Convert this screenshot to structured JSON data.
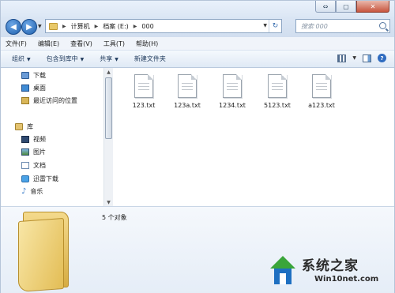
{
  "window": {
    "caption_buttons": [
      "⇔",
      "▢",
      "✕"
    ]
  },
  "address_bar": {
    "path": [
      "计算机",
      "档案 (E:)",
      "000"
    ],
    "search_placeholder": "搜索 000"
  },
  "menu": [
    "文件(F)",
    "编辑(E)",
    "查看(V)",
    "工具(T)",
    "帮助(H)"
  ],
  "toolbar": {
    "organize": "组织",
    "include_in_library": "包含到库中",
    "share": "共享",
    "new_folder": "新建文件夹"
  },
  "navigation": {
    "favorites": [
      {
        "label": "下载",
        "icon": "download-icon"
      },
      {
        "label": "桌面",
        "icon": "desktop-icon"
      },
      {
        "label": "最近访问的位置",
        "icon": "recent-places-icon"
      }
    ],
    "libraries_title": "库",
    "libraries": [
      {
        "label": "视频",
        "icon": "video-icon"
      },
      {
        "label": "图片",
        "icon": "picture-icon"
      },
      {
        "label": "文档",
        "icon": "document-icon"
      },
      {
        "label": "迅雷下载",
        "icon": "thunder-download-icon"
      },
      {
        "label": "音乐",
        "icon": "music-icon"
      }
    ]
  },
  "files": [
    {
      "name": "123.txt"
    },
    {
      "name": "123a.txt"
    },
    {
      "name": "1234.txt"
    },
    {
      "name": "5123.txt"
    },
    {
      "name": "a123.txt"
    }
  ],
  "details": {
    "count_text": "5 个对象"
  },
  "watermark": {
    "title": "系统之家",
    "site": "Win10net.com"
  },
  "colors": {
    "chrome_blue": "#dbe6f4",
    "nav_button": "#1d5fad",
    "folder_yellow": "#e3bd55"
  }
}
